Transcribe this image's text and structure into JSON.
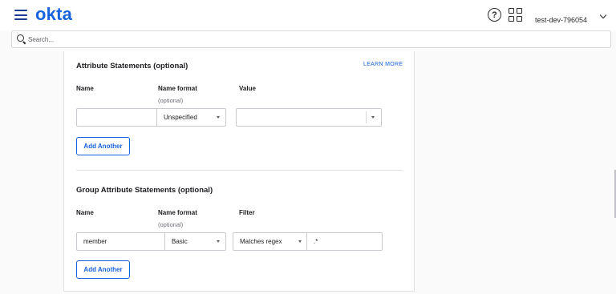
{
  "header": {
    "logo": "okta",
    "help_glyph": "?",
    "org_name": "test-dev-796054",
    "icons": [
      "hamburger-menu-icon",
      "help-icon",
      "apps-grid-icon",
      "chevron-down-icon"
    ]
  },
  "search": {
    "placeholder": "Search..."
  },
  "attribute_statements": {
    "title": "Attribute Statements (optional)",
    "learn_more": "LEARN MORE",
    "col_name": "Name",
    "col_name_format": "Name format",
    "col_name_format_sub": "(optional)",
    "col_value": "Value",
    "row": {
      "name": "",
      "name_format": "Unspecified",
      "value": ""
    },
    "add_label": "Add Another"
  },
  "group_attribute_statements": {
    "title": "Group Attribute Statements (optional)",
    "col_name": "Name",
    "col_name_format": "Name format",
    "col_name_format_sub": "(optional)",
    "col_filter": "Filter",
    "row": {
      "name": "member",
      "name_format": "Basic",
      "filter_type": "Matches regex",
      "filter_value": ".*"
    },
    "add_label": "Add Another"
  },
  "colors": {
    "brand": "#1662dd",
    "text": "#1d1d21",
    "muted": "#6e6e78",
    "border": "#c9c9cf"
  }
}
